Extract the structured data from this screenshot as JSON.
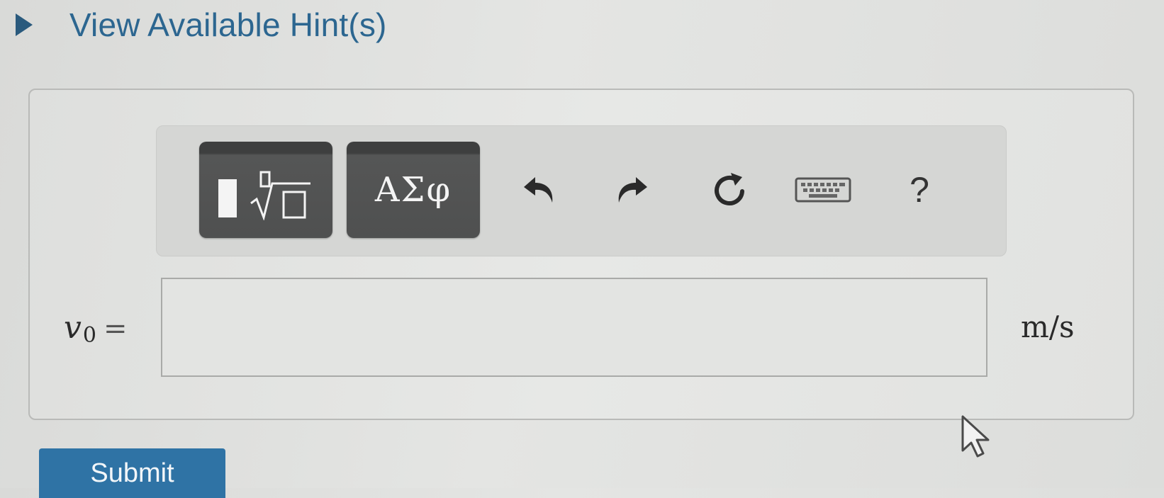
{
  "hints": {
    "toggle_label": "View Available Hint(s)",
    "icon": "triangle-right-icon"
  },
  "toolbar": {
    "templates_icon": "templates-radical-icon",
    "symbols_label": "ΑΣφ",
    "undo_icon": "undo-icon",
    "redo_icon": "redo-icon",
    "reset_icon": "reset-icon",
    "keyboard_icon": "keyboard-icon",
    "help_label": "?"
  },
  "answer": {
    "variable": "v",
    "variable_subscript": "0",
    "equals": "=",
    "value": "",
    "unit": "m/s"
  },
  "submit": {
    "label": "Submit"
  },
  "colors": {
    "link": "#2c6690",
    "submit_bg": "#2f73a5",
    "toolbar_button_bg": "#4f5050"
  }
}
